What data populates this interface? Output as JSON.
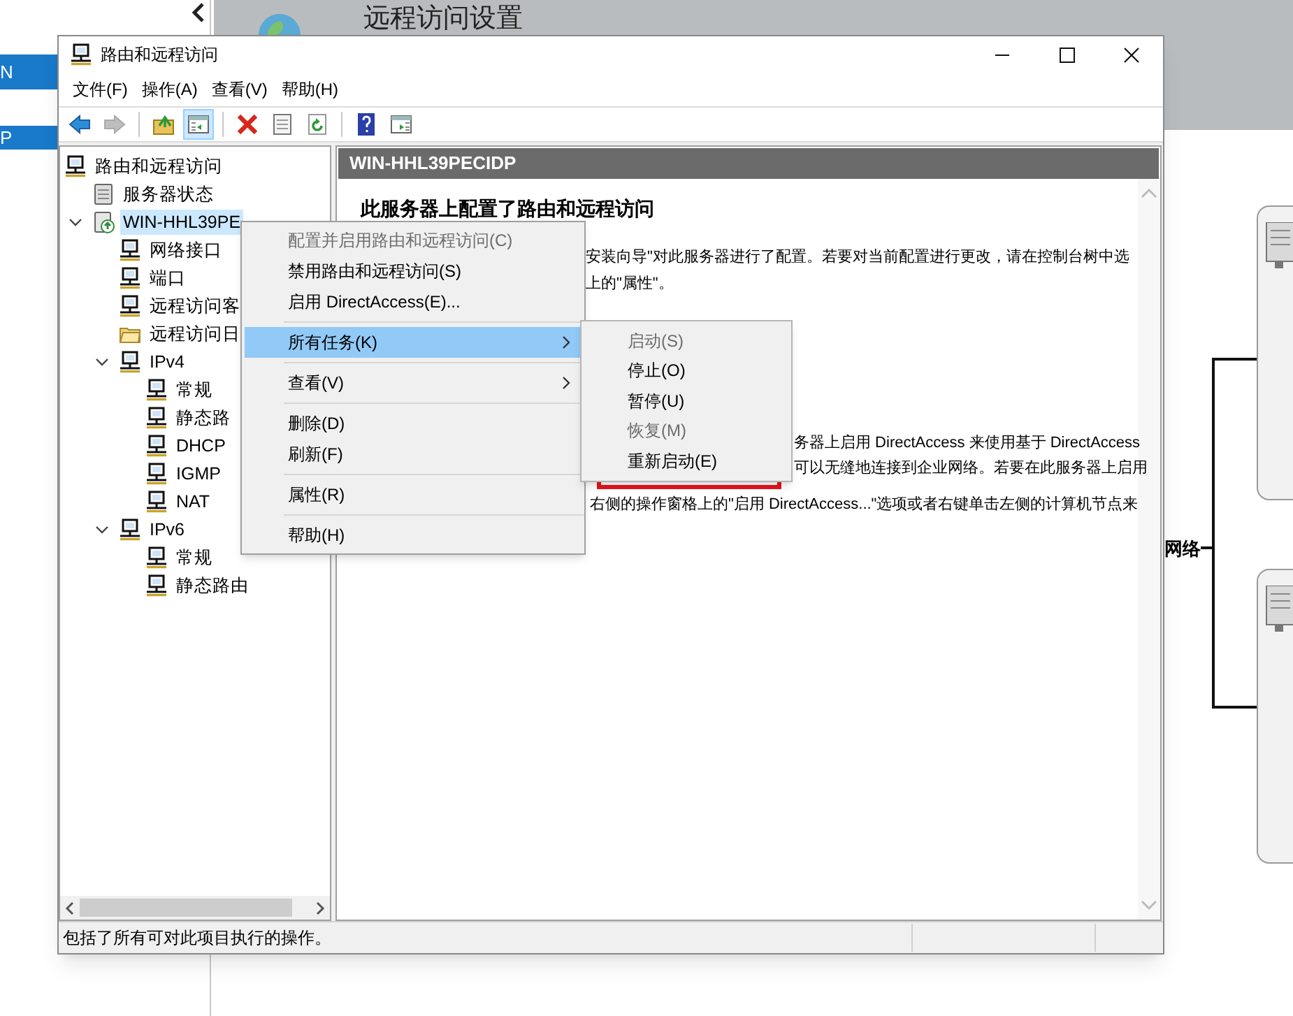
{
  "background": {
    "sidebar_items": [
      {
        "label": "N"
      },
      {
        "label": "P"
      }
    ],
    "banner_title": "远程访问设置",
    "diagram_label": "网络"
  },
  "window": {
    "title": "路由和远程访问",
    "menu": [
      "文件(F)",
      "操作(A)",
      "查看(V)",
      "帮助(H)"
    ],
    "toolbar": [
      {
        "kind": "back",
        "disabled": false,
        "selected": false
      },
      {
        "kind": "forward",
        "disabled": true,
        "selected": false
      },
      {
        "kind": "separator"
      },
      {
        "kind": "up",
        "disabled": false,
        "selected": false
      },
      {
        "kind": "tree",
        "disabled": false,
        "selected": true
      },
      {
        "kind": "separator"
      },
      {
        "kind": "delete",
        "disabled": false,
        "selected": false
      },
      {
        "kind": "properties",
        "disabled": false,
        "selected": false
      },
      {
        "kind": "refresh",
        "disabled": false,
        "selected": false
      },
      {
        "kind": "separator"
      },
      {
        "kind": "help",
        "disabled": false,
        "selected": false
      },
      {
        "kind": "panel",
        "disabled": false,
        "selected": false
      }
    ]
  },
  "tree": [
    {
      "label": "路由和远程访问",
      "kind": "node",
      "selected": false,
      "children": [
        {
          "label": "服务器状态",
          "kind": "server_status",
          "selected": false,
          "expanded": false
        },
        {
          "label": "WIN-HHL39PE",
          "kind": "server",
          "selected": true,
          "expanded": true,
          "children": [
            {
              "label": "网络接口",
              "kind": "node",
              "selected": false,
              "expanded": false
            },
            {
              "label": "端口",
              "kind": "node",
              "selected": false,
              "expanded": false
            },
            {
              "label": "远程访问客",
              "kind": "node",
              "selected": false,
              "expanded": false
            },
            {
              "label": "远程访问日",
              "kind": "folder",
              "selected": false,
              "expanded": false
            },
            {
              "label": "IPv4",
              "kind": "node",
              "selected": false,
              "expanded": true,
              "children": [
                {
                  "label": "常规",
                  "kind": "node",
                  "selected": false,
                  "expanded": false
                },
                {
                  "label": "静态路",
                  "kind": "node",
                  "selected": false,
                  "expanded": false
                },
                {
                  "label": "DHCP",
                  "kind": "node",
                  "selected": false,
                  "expanded": false
                },
                {
                  "label": "IGMP",
                  "kind": "node",
                  "selected": false,
                  "expanded": false
                },
                {
                  "label": "NAT",
                  "kind": "node",
                  "selected": false,
                  "expanded": false
                }
              ]
            },
            {
              "label": "IPv6",
              "kind": "node",
              "selected": false,
              "expanded": true,
              "children": [
                {
                  "label": "常规",
                  "kind": "node",
                  "selected": false,
                  "expanded": false
                },
                {
                  "label": "静态路由",
                  "kind": "node",
                  "selected": false,
                  "expanded": false
                }
              ]
            }
          ]
        }
      ]
    }
  ],
  "right_pane": {
    "header": "WIN-HHL39PECIDP",
    "heading": "此服务器上配置了路由和远程访问",
    "lines": [
      "安装向导\"对此服务器进行了配置。若要对当前配置进行更改，请在控制台树中选",
      "上的\"属性\"。",
      "务器上启用 DirectAccess 来使用基于 DirectAccess",
      "可以无缝地连接到企业网络。若要在此服务器上启用",
      "右侧的操作窗格上的\"启用 DirectAccess...\"选项或者右键单击左侧的计算机节点来"
    ]
  },
  "context_menu": {
    "items": [
      {
        "kind": "item",
        "label": "配置并启用路由和远程访问(C)",
        "disabled": true,
        "selected": false,
        "submenu": false
      },
      {
        "kind": "item",
        "label": "禁用路由和远程访问(S)",
        "disabled": false,
        "selected": false,
        "submenu": false
      },
      {
        "kind": "item",
        "label": "启用 DirectAccess(E)...",
        "disabled": false,
        "selected": false,
        "submenu": false
      },
      {
        "kind": "separator"
      },
      {
        "kind": "item",
        "label": "所有任务(K)",
        "disabled": false,
        "selected": true,
        "submenu": true
      },
      {
        "kind": "separator"
      },
      {
        "kind": "item",
        "label": "查看(V)",
        "disabled": false,
        "selected": false,
        "submenu": true
      },
      {
        "kind": "separator"
      },
      {
        "kind": "item",
        "label": "删除(D)",
        "disabled": false,
        "selected": false,
        "submenu": false
      },
      {
        "kind": "item",
        "label": "刷新(F)",
        "disabled": false,
        "selected": false,
        "submenu": false
      },
      {
        "kind": "separator"
      },
      {
        "kind": "item",
        "label": "属性(R)",
        "disabled": false,
        "selected": false,
        "submenu": false
      },
      {
        "kind": "separator"
      },
      {
        "kind": "item",
        "label": "帮助(H)",
        "disabled": false,
        "selected": false,
        "submenu": false
      }
    ],
    "submenu": [
      {
        "label": "启动(S)",
        "disabled": true,
        "framed": false
      },
      {
        "label": "停止(O)",
        "disabled": false,
        "framed": false
      },
      {
        "label": "暂停(U)",
        "disabled": false,
        "framed": false
      },
      {
        "label": "恢复(M)",
        "disabled": true,
        "framed": false
      },
      {
        "label": "重新启动(E)",
        "disabled": false,
        "framed": true
      }
    ]
  },
  "status_bar": {
    "text": "包括了所有可对此项目执行的操作。"
  }
}
